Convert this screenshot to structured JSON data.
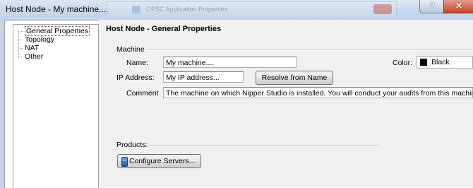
{
  "window": {
    "title": "Host Node - My machine....",
    "background_window_title": "OPSC Application Properties",
    "help_glyph": "?",
    "close_glyph": "✕"
  },
  "tree": {
    "items": [
      {
        "label": "General Properties",
        "selected": true
      },
      {
        "label": "Topology",
        "selected": false
      },
      {
        "label": "NAT",
        "selected": false
      },
      {
        "label": "Other",
        "selected": false
      }
    ]
  },
  "panel": {
    "heading": "Host Node - General Properties",
    "machine_section": "Machine",
    "name_label": "Name:",
    "name_value": "My machine....",
    "ip_label": "IP Address:",
    "ip_value": "My IP address...",
    "resolve_button": "Resolve from Name",
    "comment_label": "Comment",
    "comment_value": "The machine on which Nipper Studio is installed.  You will conduct your audits from this machine...",
    "color_label": "Color:",
    "color_value": "Black",
    "color_swatch": "#000000",
    "products_label": "Products:",
    "configure_servers_button": "Configure Servers..."
  }
}
